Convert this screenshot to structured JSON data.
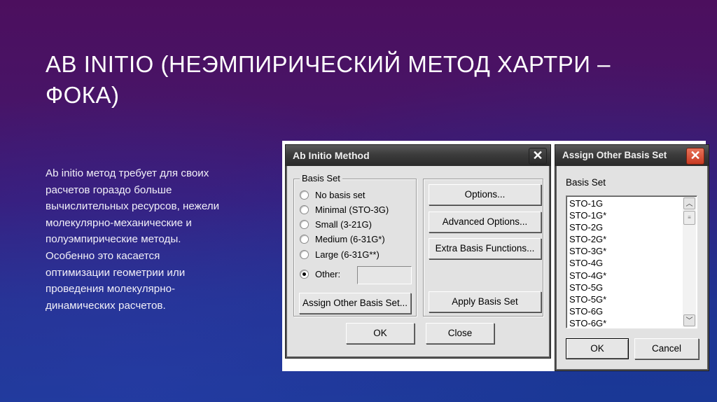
{
  "slide": {
    "title": "AB INITIO (НЕЭМПИРИЧЕСКИЙ МЕТОД ХАРТРИ – ФОКА)",
    "body": "Ab initio метод  требует для своих\nрасчетов гораздо больше\nвычислительных ресурсов, нежели\nмолекулярно-механические и\nполуэмпирические методы.\nОсобенно это касается\nоптимизации геометрии или\nпроведения молекулярно-\nдинамических расчетов."
  },
  "ab_initio_dialog": {
    "title": "Ab Initio Method",
    "close_icon": "close-icon",
    "basis_group_label": "Basis Set",
    "radios": [
      {
        "label": "No basis set",
        "selected": false
      },
      {
        "label": "Minimal (STO-3G)",
        "selected": false
      },
      {
        "label": "Small (3-21G)",
        "selected": false
      },
      {
        "label": "Medium (6-31G*)",
        "selected": false
      },
      {
        "label": "Large (6-31G**)",
        "selected": false
      },
      {
        "label": "Other:",
        "selected": true
      }
    ],
    "other_value": "",
    "assign_other_label": "Assign Other Basis Set...",
    "options_label": "Options...",
    "advanced_options_label": "Advanced Options...",
    "extra_basis_label": "Extra Basis Functions...",
    "apply_basis_label": "Apply Basis Set",
    "ok_label": "OK",
    "close_label": "Close"
  },
  "assign_dialog": {
    "title": "Assign Other Basis Set",
    "close_icon": "close-icon",
    "list_label": "Basis Set",
    "items": [
      "STO-1G",
      "STO-1G*",
      "STO-2G",
      "STO-2G*",
      "STO-3G*",
      "STO-4G",
      "STO-4G*",
      "STO-5G",
      "STO-5G*",
      "STO-6G",
      "STO-6G*"
    ],
    "scroll_up_icon": "chevron-up-icon",
    "scroll_down_icon": "chevron-down-icon",
    "ok_label": "OK",
    "cancel_label": "Cancel"
  }
}
